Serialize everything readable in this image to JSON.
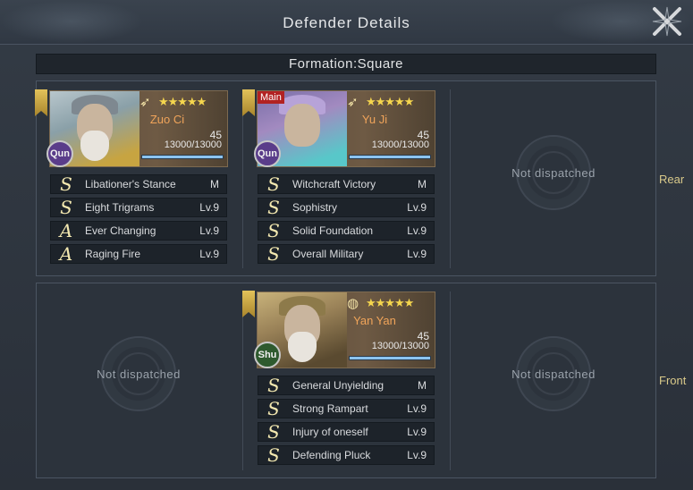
{
  "header": {
    "title": "Defender Details"
  },
  "formation": {
    "label": "Formation:Square"
  },
  "rows": {
    "rear": "Rear",
    "front": "Front"
  },
  "empty_label": "Not dispatched",
  "heroes": {
    "zuoci": {
      "name": "Zuo Ci",
      "level": "45",
      "troops": "13000/13000",
      "faction": "Qun",
      "stars": "★★★★★",
      "troop_fraction": 1.0,
      "skills": [
        {
          "grade": "S",
          "name": "Libationer's Stance",
          "level": "M"
        },
        {
          "grade": "S",
          "name": "Eight Trigrams",
          "level": "Lv.9"
        },
        {
          "grade": "A",
          "name": "Ever Changing",
          "level": "Lv.9"
        },
        {
          "grade": "A",
          "name": "Raging Fire",
          "level": "Lv.9"
        }
      ]
    },
    "yuji": {
      "name": "Yu Ji",
      "level": "45",
      "troops": "13000/13000",
      "faction": "Qun",
      "stars": "★★★★★",
      "main_tag": "Main",
      "troop_fraction": 1.0,
      "skills": [
        {
          "grade": "S",
          "name": "Witchcraft Victory",
          "level": "M"
        },
        {
          "grade": "S",
          "name": "Sophistry",
          "level": "Lv.9"
        },
        {
          "grade": "S",
          "name": "Solid Foundation",
          "level": "Lv.9"
        },
        {
          "grade": "S",
          "name": "Overall Military",
          "level": "Lv.9"
        }
      ]
    },
    "yanyan": {
      "name": "Yan Yan",
      "level": "45",
      "troops": "13000/13000",
      "faction": "Shu",
      "stars": "★★★★★",
      "troop_fraction": 1.0,
      "skills": [
        {
          "grade": "S",
          "name": "General Unyielding",
          "level": "M"
        },
        {
          "grade": "S",
          "name": "Strong Rampart",
          "level": "Lv.9"
        },
        {
          "grade": "S",
          "name": "Injury of oneself",
          "level": "Lv.9"
        },
        {
          "grade": "S",
          "name": "Defending Pluck",
          "level": "Lv.9"
        }
      ]
    }
  },
  "icons": {
    "close": "close-x-icon",
    "bow": "bow-icon",
    "shield": "shield-icon",
    "banner": "banner-icon",
    "emblem": "empty-slot-emblem-icon"
  },
  "colors": {
    "hero_name": "#f0a45a",
    "stars": "#f5d64e",
    "row_label": "#d9c98a",
    "faction_qun": "#5a3d8a",
    "faction_shu": "#2e5a2e"
  }
}
